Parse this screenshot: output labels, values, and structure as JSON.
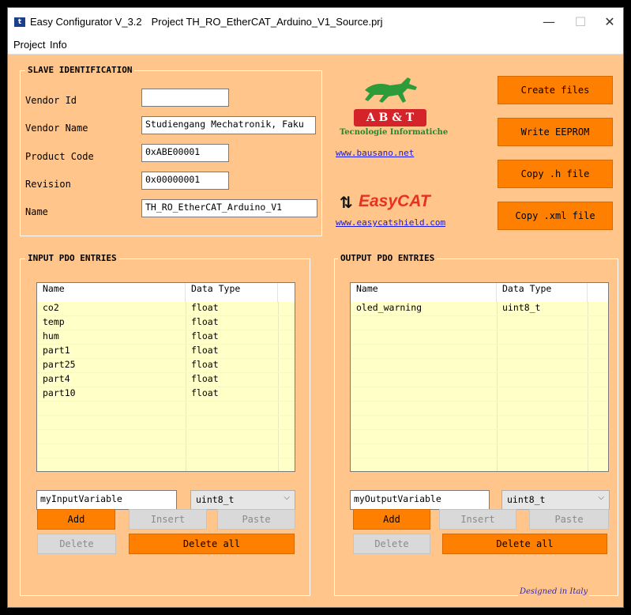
{
  "window": {
    "app_title": "Easy Configurator V_3.2",
    "project_title": "Project TH_RO_EtherCAT_Arduino_V1_Source.prj",
    "minimize": "—",
    "maximize": "☐",
    "close": "✕"
  },
  "menu": [
    "Project",
    "Info"
  ],
  "slave_identification": {
    "title": "SLAVE IDENTIFICATION",
    "fields": [
      {
        "label": "Vendor Id",
        "value": ""
      },
      {
        "label": "Vendor Name",
        "value": "Studiengang Mechatronik, Faku"
      },
      {
        "label": "Product Code",
        "value": "0xABE00001"
      },
      {
        "label": "Revision",
        "value": "0x00000001"
      },
      {
        "label": "Name",
        "value": "TH_RO_EtherCAT_Arduino_V1"
      }
    ]
  },
  "logos": {
    "abt_letters": "A B & T",
    "abt_subtitle": "Tecnologie Informatiche",
    "abt_link": "www.bausano.net",
    "easycat_text": "EasyCAT",
    "easycat_link": "www.easycatshield.com"
  },
  "actions": {
    "create_files": "Create files",
    "write_eeprom": "Write EEPROM",
    "copy_h": "Copy .h file",
    "copy_xml": "Copy .xml file"
  },
  "input_pdo": {
    "title": "INPUT PDO ENTRIES",
    "col_name": "Name",
    "col_type": "Data Type",
    "rows": [
      {
        "name": "co2",
        "type": "float"
      },
      {
        "name": "temp",
        "type": "float"
      },
      {
        "name": "hum",
        "type": "float"
      },
      {
        "name": "part1",
        "type": "float"
      },
      {
        "name": "part25",
        "type": "float"
      },
      {
        "name": "part4",
        "type": "float"
      },
      {
        "name": "part10",
        "type": "float"
      }
    ],
    "variable": "myInputVariable",
    "type_selected": "uint8_t",
    "add": "Add",
    "insert": "Insert",
    "paste": "Paste",
    "delete": "Delete",
    "delete_all": "Delete all"
  },
  "output_pdo": {
    "title": "OUTPUT PDO ENTRIES",
    "col_name": "Name",
    "col_type": "Data Type",
    "rows": [
      {
        "name": "oled_warning",
        "type": "uint8_t"
      }
    ],
    "variable": "myOutputVariable",
    "type_selected": "uint8_t",
    "add": "Add",
    "insert": "Insert",
    "paste": "Paste",
    "delete": "Delete",
    "delete_all": "Delete all"
  },
  "footer": "Designed in Italy",
  "colors": {
    "background": "#ffc58a",
    "button_orange": "#ff7f00",
    "list_yellow": "#ffffc8",
    "link_blue": "#1a1adf"
  }
}
